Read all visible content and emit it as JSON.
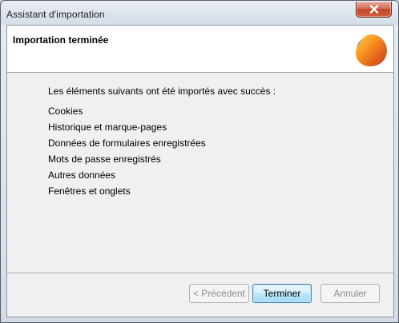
{
  "window": {
    "title": "Assistant d'importation"
  },
  "header": {
    "title": "Importation terminée",
    "logo_icon": "firefox-logo-icon"
  },
  "content": {
    "intro": "Les éléments suivants ont été importés avec succès :",
    "items": [
      "Cookies",
      "Historique et marque-pages",
      "Données de formulaires enregistrées",
      "Mots de passe enregistrés",
      "Autres données",
      "Fenêtres et onglets"
    ]
  },
  "buttons": {
    "back_label": "< Précédent",
    "finish_label": "Terminer",
    "cancel_label": "Annuler"
  },
  "colors": {
    "close_button": "#c3462c",
    "default_button_border": "#3c7fb1",
    "client_background": "#f0f0f0"
  }
}
